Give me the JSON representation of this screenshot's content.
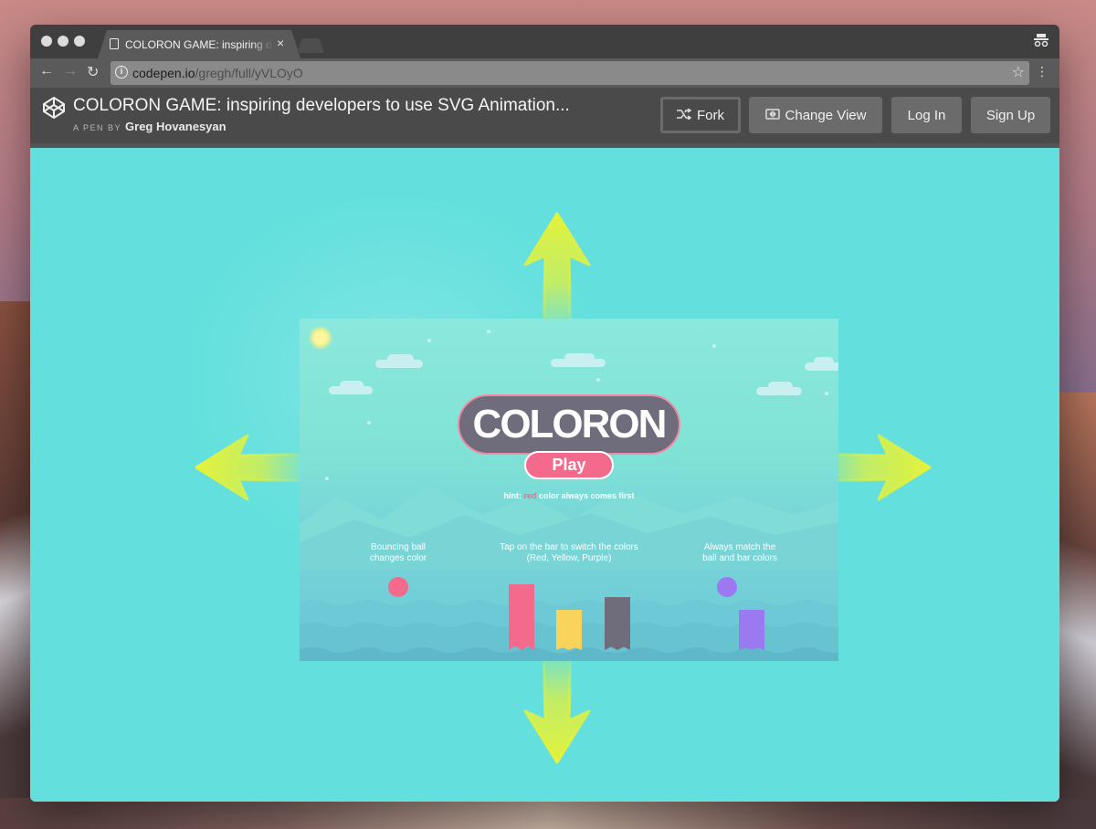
{
  "browser": {
    "tab_title": "COLORON GAME: inspiring developers to use SVG Animation...",
    "tab_close": "×",
    "url_domain": "codepen.io",
    "url_path": "/gregh/full/yVLOyO",
    "nav": {
      "back": "←",
      "forward": "→",
      "reload": "↻"
    },
    "star": "☆",
    "menu": "⋮",
    "incognito": "👓"
  },
  "codepen": {
    "pen_title": "COLORON GAME: inspiring developers to use SVG Animation...",
    "by_label": "A PEN BY",
    "author": "Greg Hovanesyan",
    "buttons": {
      "fork": "Fork",
      "change_view": "Change View",
      "log_in": "Log In",
      "sign_up": "Sign Up"
    }
  },
  "game": {
    "title": "COLORON",
    "play": "Play",
    "hint_prefix": "hint: ",
    "hint_color_word": "red",
    "hint_suffix": " color always comes first",
    "instructions": {
      "left_line1": "Bouncing ball",
      "left_line2": "changes color",
      "center_line1": "Tap on the bar to switch the colors",
      "center_line2": "(Red, Yellow, Purple)",
      "right_line1": "Always match the",
      "right_line2": "ball and bar colors"
    }
  },
  "colors": {
    "stage_bg": "#63e0dd",
    "arrow": "#e4f23a",
    "red": "#f36a8c",
    "yellow": "#f9d35a",
    "dark": "#6f6c7c",
    "purple": "#9b79f0"
  }
}
